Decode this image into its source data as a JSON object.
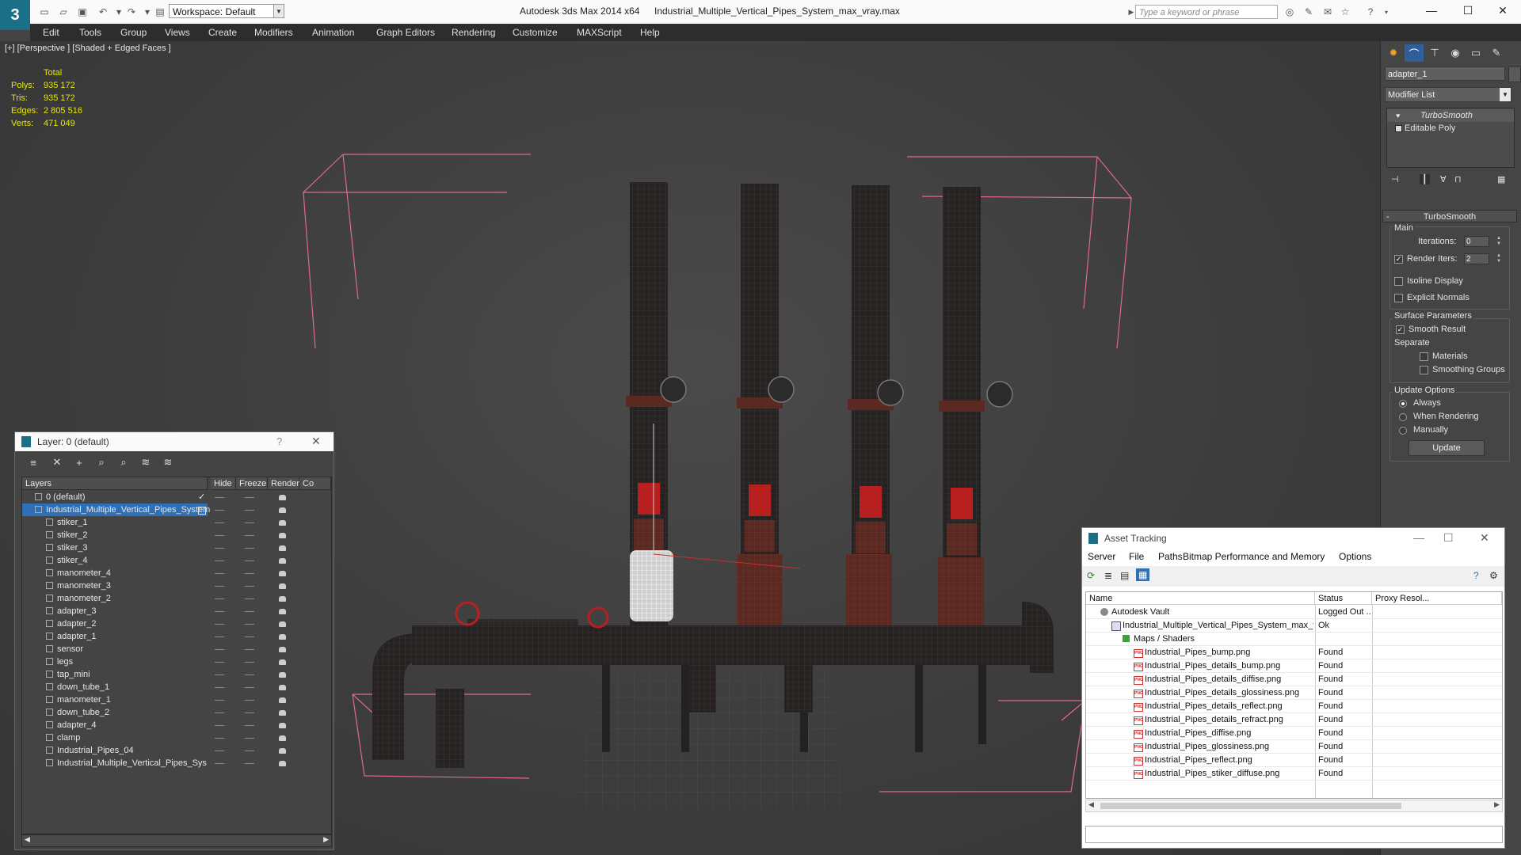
{
  "app": {
    "title": "Autodesk 3ds Max  2014 x64",
    "filename": "Industrial_Multiple_Vertical_Pipes_System_max_vray.max",
    "workspace": "Workspace: Default",
    "search_placeholder": "Type a keyword or phrase"
  },
  "menu": [
    "Edit",
    "Tools",
    "Group",
    "Views",
    "Create",
    "Modifiers",
    "Animation",
    "Graph Editors",
    "Rendering",
    "Customize",
    "MAXScript",
    "Help"
  ],
  "viewport": {
    "label": "[+] [Perspective ] [Shaded + Edged Faces ]",
    "stats": {
      "header": "Total",
      "rows": [
        {
          "label": "Polys:",
          "value": "935 172"
        },
        {
          "label": "Tris:",
          "value": "935 172"
        },
        {
          "label": "Edges:",
          "value": "2 805 516"
        },
        {
          "label": "Verts:",
          "value": "471 049"
        }
      ]
    }
  },
  "command_panel": {
    "object_name": "adapter_1",
    "modifier_list": "Modifier List",
    "stack": [
      "TurboSmooth",
      "Editable Poly"
    ],
    "rollout_title": "TurboSmooth",
    "main_label": "Main",
    "iterations_label": "Iterations:",
    "iterations_value": "0",
    "render_iters_label": "Render Iters:",
    "render_iters_value": "2",
    "isoline": "Isoline Display",
    "explicit": "Explicit Normals",
    "surface_params": "Surface Parameters",
    "smooth_result": "Smooth Result",
    "separate": "Separate",
    "materials": "Materials",
    "smoothing_groups": "Smoothing Groups",
    "update_options": "Update Options",
    "always": "Always",
    "when_rendering": "When Rendering",
    "manually": "Manually",
    "update": "Update"
  },
  "layer_dialog": {
    "title": "Layer: 0 (default)",
    "help": "?",
    "columns": [
      "Layers",
      "Hide",
      "Freeze",
      "Render",
      "Co"
    ],
    "rows": [
      {
        "name": "0 (default)",
        "level": 0,
        "type": "layer"
      },
      {
        "name": "Industrial_Multiple_Vertical_Pipes_System",
        "level": 0,
        "type": "layer",
        "selected": true
      },
      {
        "name": "stiker_1",
        "level": 1,
        "type": "obj"
      },
      {
        "name": "stiker_2",
        "level": 1,
        "type": "obj"
      },
      {
        "name": "stiker_3",
        "level": 1,
        "type": "obj"
      },
      {
        "name": "stiker_4",
        "level": 1,
        "type": "obj"
      },
      {
        "name": "manometer_4",
        "level": 1,
        "type": "obj"
      },
      {
        "name": "manometer_3",
        "level": 1,
        "type": "obj"
      },
      {
        "name": "manometer_2",
        "level": 1,
        "type": "obj"
      },
      {
        "name": "adapter_3",
        "level": 1,
        "type": "obj"
      },
      {
        "name": "adapter_2",
        "level": 1,
        "type": "obj"
      },
      {
        "name": "adapter_1",
        "level": 1,
        "type": "obj"
      },
      {
        "name": "sensor",
        "level": 1,
        "type": "obj"
      },
      {
        "name": "legs",
        "level": 1,
        "type": "obj"
      },
      {
        "name": "tap_mini",
        "level": 1,
        "type": "obj"
      },
      {
        "name": "down_tube_1",
        "level": 1,
        "type": "obj"
      },
      {
        "name": "manometer_1",
        "level": 1,
        "type": "obj"
      },
      {
        "name": "down_tube_2",
        "level": 1,
        "type": "obj"
      },
      {
        "name": "adapter_4",
        "level": 1,
        "type": "obj"
      },
      {
        "name": "clamp",
        "level": 1,
        "type": "obj"
      },
      {
        "name": "Industrial_Pipes_04",
        "level": 1,
        "type": "obj"
      },
      {
        "name": "Industrial_Multiple_Vertical_Pipes_Sys",
        "level": 1,
        "type": "obj"
      }
    ]
  },
  "asset_tracking": {
    "title": "Asset Tracking",
    "menu": [
      "Server",
      "File",
      "Paths",
      "Bitmap Performance and Memory",
      "Options"
    ],
    "columns": [
      "Name",
      "Status",
      "Proxy Resol..."
    ],
    "rows": [
      {
        "name": "Autodesk Vault",
        "status": "Logged Out ...",
        "level": 0,
        "icon": "vault"
      },
      {
        "name": "Industrial_Multiple_Vertical_Pipes_System_max_vray.max",
        "status": "Ok",
        "level": 1,
        "icon": "max"
      },
      {
        "name": "Maps / Shaders",
        "status": "",
        "level": 2,
        "icon": "maps"
      },
      {
        "name": "Industrial_Pipes_bump.png",
        "status": "Found",
        "level": 3,
        "icon": "png"
      },
      {
        "name": "Industrial_Pipes_details_bump.png",
        "status": "Found",
        "level": 3,
        "icon": "png"
      },
      {
        "name": "Industrial_Pipes_details_diffise.png",
        "status": "Found",
        "level": 3,
        "icon": "png"
      },
      {
        "name": "Industrial_Pipes_details_glossiness.png",
        "status": "Found",
        "level": 3,
        "icon": "png"
      },
      {
        "name": "Industrial_Pipes_details_reflect.png",
        "status": "Found",
        "level": 3,
        "icon": "png"
      },
      {
        "name": "Industrial_Pipes_details_refract.png",
        "status": "Found",
        "level": 3,
        "icon": "png"
      },
      {
        "name": "Industrial_Pipes_diffise.png",
        "status": "Found",
        "level": 3,
        "icon": "png"
      },
      {
        "name": "Industrial_Pipes_glossiness.png",
        "status": "Found",
        "level": 3,
        "icon": "png"
      },
      {
        "name": "Industrial_Pipes_reflect.png",
        "status": "Found",
        "level": 3,
        "icon": "png"
      },
      {
        "name": "Industrial_Pipes_stiker_diffuse.png",
        "status": "Found",
        "level": 3,
        "icon": "png"
      }
    ]
  },
  "colors": {
    "accent": "#1b6f86",
    "selection": "#2f6fb5",
    "stats_text": "#e6e60a",
    "bbox": "#e06a8a"
  }
}
